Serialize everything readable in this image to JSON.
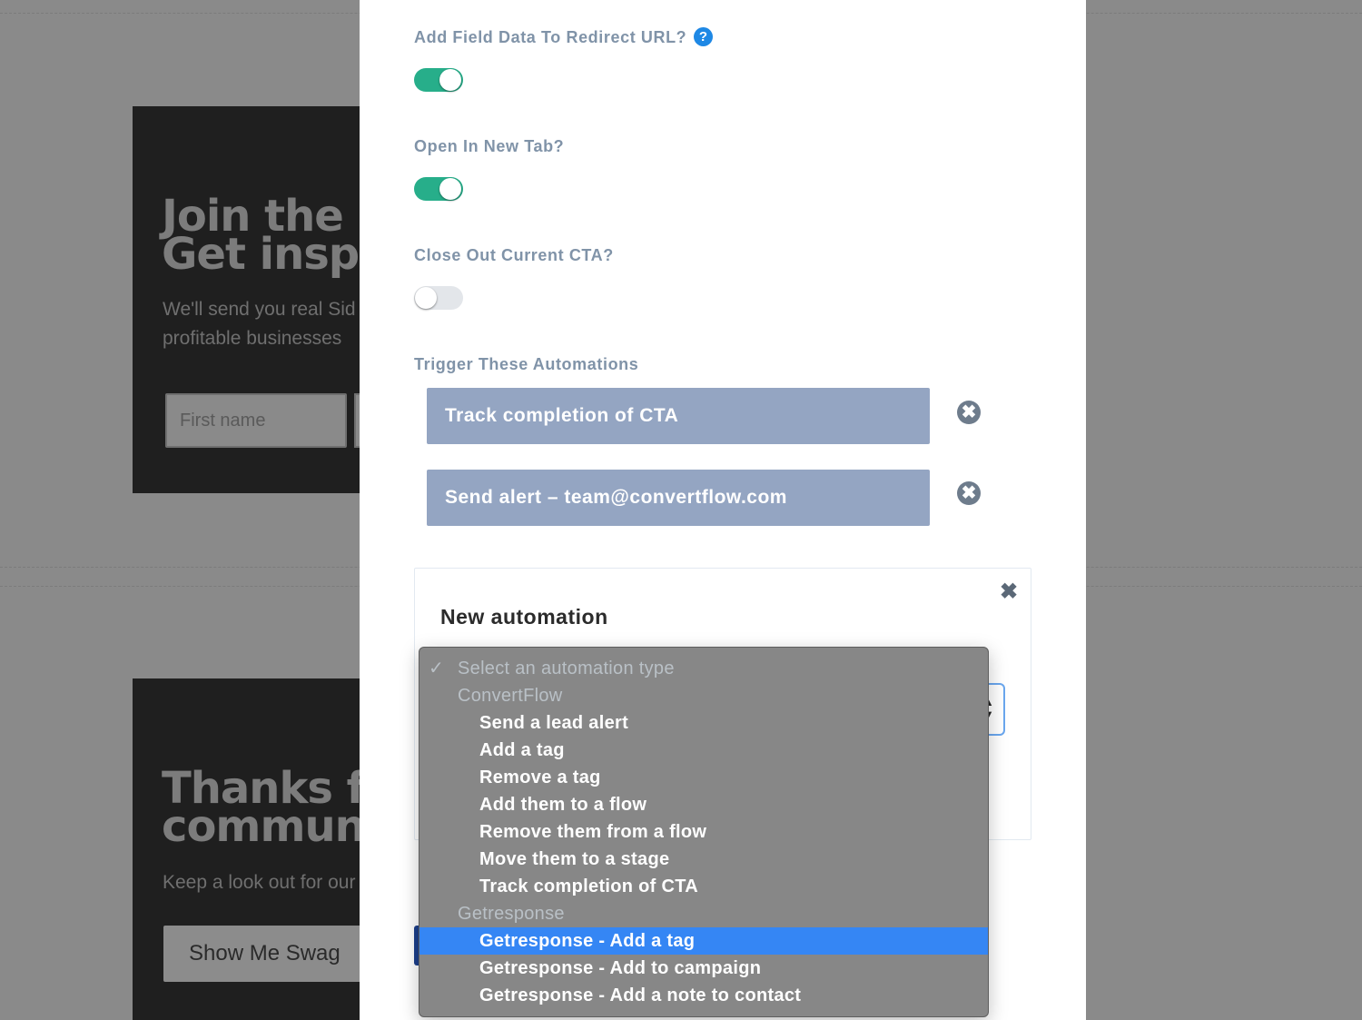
{
  "background": {
    "card1": {
      "title_line1": "Join the S",
      "title_line2": "Get inspi",
      "sub_line1": "We'll send you real Sid",
      "sub_line2": "profitable businesses",
      "input_placeholder": "First name"
    },
    "card2": {
      "title_line1": "Thanks fo",
      "title_line2": "communi",
      "sub_line1": "Keep a look out for our",
      "button_label": "Show Me Swag"
    }
  },
  "panel": {
    "redirect_field": {
      "label": "Add Field Data To Redirect URL?",
      "help_icon": "?",
      "enabled": true
    },
    "new_tab_field": {
      "label": "Open In New Tab?",
      "enabled": true
    },
    "close_cta_field": {
      "label": "Close Out Current CTA?",
      "enabled": false
    },
    "automations": {
      "label": "Trigger These Automations",
      "items": [
        {
          "label": "Track completion of CTA"
        },
        {
          "label": "Send alert – team@convertflow.com"
        }
      ],
      "remove_icon": "✖"
    },
    "new_automation": {
      "title": "New automation",
      "close_icon": "✖",
      "select_arrows": "▲▼"
    }
  },
  "dropdown": {
    "checkmark": "✓",
    "options": [
      {
        "label": "Select an automation type",
        "kind": "disabled",
        "checked": true
      },
      {
        "label": "ConvertFlow",
        "kind": "disabled"
      },
      {
        "label": "Send a lead alert",
        "kind": "child"
      },
      {
        "label": "Add a tag",
        "kind": "child"
      },
      {
        "label": "Remove a tag",
        "kind": "child"
      },
      {
        "label": "Add them to a flow",
        "kind": "child"
      },
      {
        "label": "Remove them from a flow",
        "kind": "child"
      },
      {
        "label": "Move them to a stage",
        "kind": "child"
      },
      {
        "label": "Track completion of CTA",
        "kind": "child"
      },
      {
        "label": "Getresponse",
        "kind": "disabled"
      },
      {
        "label": "Getresponse - Add a tag",
        "kind": "child",
        "selected": true
      },
      {
        "label": "Getresponse - Add to campaign",
        "kind": "child"
      },
      {
        "label": "Getresponse - Add a note to contact",
        "kind": "child"
      }
    ]
  },
  "colors": {
    "toggle_on": "#27ae8a",
    "automation_item": "#94a5c2",
    "selected_option": "#3586f4",
    "label_text": "#8093a8"
  }
}
